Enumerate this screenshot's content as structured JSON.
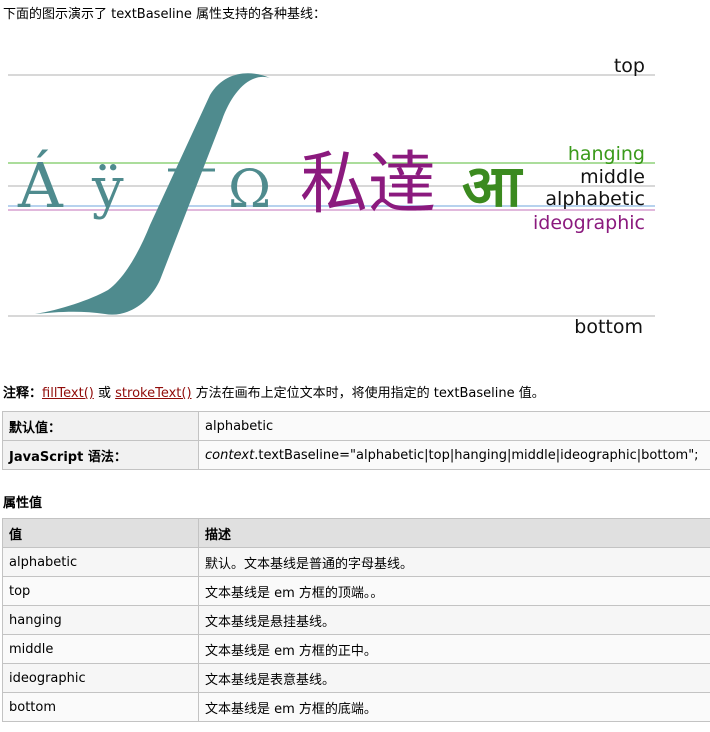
{
  "intro_text": "下面的图示演示了 textBaseline 属性支持的各种基线：",
  "figure": {
    "glyphs": {
      "a_acute": "Á",
      "y_uml": "ÿ",
      "f": "ƒ",
      "omega": "Ω",
      "cjk": "私達",
      "deva": "आ"
    },
    "labels": {
      "top": "top",
      "hanging": "hanging",
      "middle": "middle",
      "alphabetic": "alphabetic",
      "ideographic": "ideographic",
      "bottom": "bottom"
    },
    "colors": {
      "latin": "#4f8b8e",
      "cjk": "#8b1a7e",
      "deva": "#3b8a1f",
      "hanging": "#3a9a1a",
      "ideographic": "#8b1a7e",
      "line_gray": "#cccccc",
      "line_green": "#8fd27a",
      "line_blue": "#9fc3e8",
      "line_pink": "#d7a0d0"
    }
  },
  "note": {
    "label": "注释：",
    "link1": "fillText()",
    "sep": " 或 ",
    "link2": "strokeText()",
    "rest": " 方法在画布上定位文本时，将使用指定的 textBaseline 值。"
  },
  "defaults": {
    "default_label": "默认值：",
    "default_value": "alphabetic",
    "syntax_label": "JavaScript 语法：",
    "syntax_italic": "context",
    "syntax_rest": ".textBaseline=\"alphabetic|top|hanging|middle|ideographic|bottom\";"
  },
  "section_title": "属性值",
  "values_table": {
    "headers": [
      "值",
      "描述"
    ],
    "rows": [
      [
        "alphabetic",
        "默认。文本基线是普通的字母基线。"
      ],
      [
        "top",
        "文本基线是 em 方框的顶端。。"
      ],
      [
        "hanging",
        "文本基线是悬挂基线。"
      ],
      [
        "middle",
        "文本基线是 em 方框的正中。"
      ],
      [
        "ideographic",
        "文本基线是表意基线。"
      ],
      [
        "bottom",
        "文本基线是 em 方框的底端。"
      ]
    ]
  }
}
